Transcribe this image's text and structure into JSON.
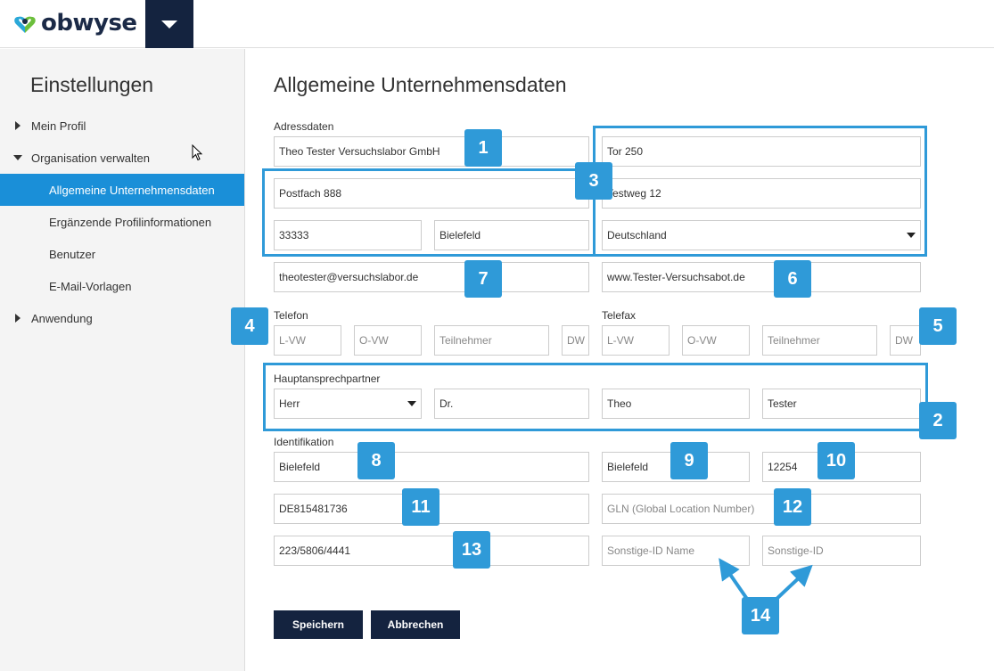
{
  "header": {
    "logo_text": "obwyse",
    "menu_icon": "caret-down-icon"
  },
  "sidebar": {
    "title": "Einstellungen",
    "items": [
      {
        "label": "Mein Profil",
        "icon": "chevron-right-icon"
      },
      {
        "label": "Organisation verwalten",
        "icon": "chevron-down-icon"
      },
      {
        "label": "Allgemeine Unternehmensdaten"
      },
      {
        "label": "Ergänzende Profilinformationen"
      },
      {
        "label": "Benutzer"
      },
      {
        "label": "E-Mail-Vorlagen"
      },
      {
        "label": "Anwendung",
        "icon": "chevron-right-icon"
      }
    ]
  },
  "main": {
    "title": "Allgemeine Unternehmensdaten",
    "labels": {
      "adressdaten": "Adressdaten",
      "telefon": "Telefon",
      "telefax": "Telefax",
      "hauptansprechpartner": "Hauptansprechpartner",
      "identifikation": "Identifikation"
    },
    "fields": {
      "company_name": "Theo Tester Versuchslabor GmbH",
      "gate": "Tor 250",
      "po_box": "Postfach 888",
      "street": "Testweg 12",
      "zip": "33333",
      "city": "Bielefeld",
      "country": "Deutschland",
      "email": "theotester@versuchslabor.de",
      "website": "www.Tester-Versuchsabot.de",
      "tel_lvw": "L-VW",
      "tel_ovw": "O-VW",
      "tel_teilnehmer": "Teilnehmer",
      "tel_dw": "DW",
      "fax_lvw": "L-VW",
      "fax_ovw": "O-VW",
      "fax_teilnehmer": "Teilnehmer",
      "fax_dw": "DW",
      "salutation": "Herr",
      "academic_title": "Dr.",
      "first_name": "Theo",
      "last_name": "Tester",
      "id_city": "Bielefeld",
      "register_court": "Bielefeld",
      "register_number": "12254",
      "vat_id": "DE815481736",
      "gln": "GLN (Global Location Number)",
      "tax_number": "223/5806/4441",
      "other_id_name": "Sonstige-ID Name",
      "other_id": "Sonstige-ID"
    },
    "badges": [
      "1",
      "2",
      "3",
      "4",
      "5",
      "6",
      "7",
      "8",
      "9",
      "10",
      "11",
      "12",
      "13",
      "14"
    ],
    "buttons": {
      "save": "Speichern",
      "cancel": "Abbrechen"
    },
    "accent_color": "#2f9ad8",
    "nav_active_color": "#1a8fd8",
    "button_color": "#14233f"
  }
}
